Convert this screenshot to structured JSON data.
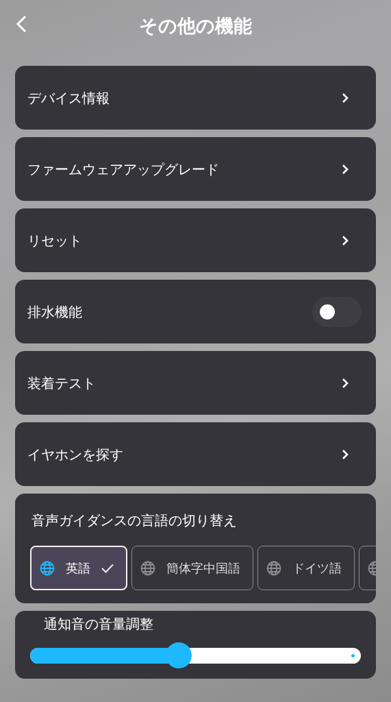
{
  "header": {
    "title": "その他の機能"
  },
  "items": [
    {
      "kind": "link",
      "label": "デバイス情報"
    },
    {
      "kind": "link",
      "label": "ファームウェアアップグレード"
    },
    {
      "kind": "link",
      "label": "リセット"
    },
    {
      "kind": "toggle",
      "label": "排水機能",
      "on": false
    },
    {
      "kind": "link",
      "label": "装着テスト"
    },
    {
      "kind": "link",
      "label": "イヤホンを探す"
    }
  ],
  "language": {
    "title": "音声ガイダンスの言語の切り替え",
    "options": [
      {
        "label": "英語",
        "selected": true
      },
      {
        "label": "簡体字中国語",
        "selected": false
      },
      {
        "label": "ドイツ語",
        "selected": false
      },
      {
        "selected": false
      }
    ]
  },
  "volume": {
    "title": "通知音の音量調整",
    "level": 0.45
  }
}
